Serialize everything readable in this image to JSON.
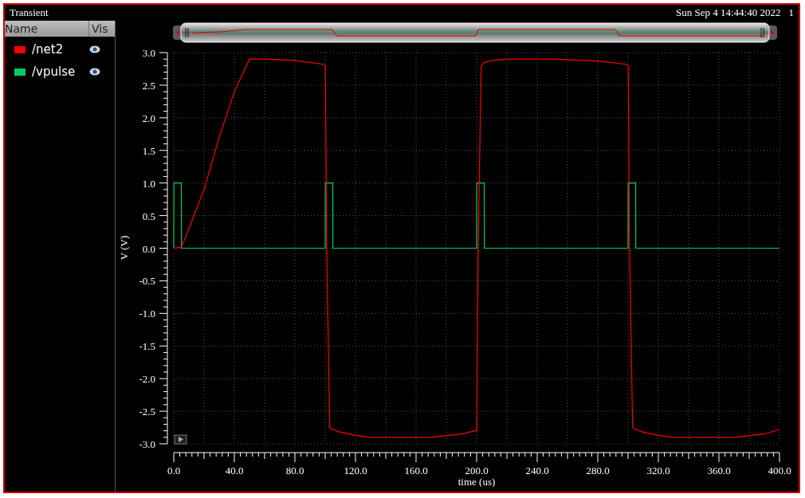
{
  "window": {
    "title": "Transient",
    "timestamp": "Sun Sep 4 14:44:40 2022",
    "number": "1"
  },
  "panel": {
    "columns": [
      "Name",
      "Vis"
    ]
  },
  "chart_data": {
    "type": "line",
    "grid": true,
    "xlabel": "time (us)",
    "ylabel": "V (V)",
    "x": [
      0,
      0.1,
      5,
      5.1,
      10,
      20,
      30,
      40,
      50,
      60,
      80,
      99,
      100,
      100.1,
      101,
      103,
      105,
      105.1,
      110,
      120,
      130,
      150,
      170,
      190,
      199,
      200,
      200.1,
      201,
      203,
      205,
      205.1,
      210,
      220,
      250,
      280,
      299,
      300,
      300.1,
      301,
      303,
      305,
      305.1,
      310,
      320,
      330,
      350,
      370,
      390,
      400
    ],
    "series": [
      {
        "name": "/net2",
        "color": "#ff0000",
        "values": [
          0,
          0,
          0.02,
          0.02,
          0.3,
          0.9,
          1.7,
          2.4,
          2.9,
          2.9,
          2.88,
          2.82,
          2.8,
          2.8,
          0,
          -2.75,
          -2.78,
          -2.78,
          -2.82,
          -2.87,
          -2.9,
          -2.9,
          -2.9,
          -2.85,
          -2.8,
          -2.8,
          -2.8,
          0,
          2.8,
          2.85,
          2.85,
          2.88,
          2.9,
          2.9,
          2.87,
          2.82,
          2.8,
          2.8,
          0,
          -2.75,
          -2.78,
          -2.78,
          -2.82,
          -2.87,
          -2.9,
          -2.9,
          -2.9,
          -2.85,
          -2.78
        ]
      },
      {
        "name": "/vpulse",
        "color": "#00cc66",
        "values": [
          0,
          1,
          1,
          0,
          0,
          0,
          0,
          0,
          0,
          0,
          0,
          0,
          0,
          1,
          1,
          1,
          1,
          0,
          0,
          0,
          0,
          0,
          0,
          0,
          0,
          0,
          1,
          1,
          1,
          1,
          0,
          0,
          0,
          0,
          0,
          0,
          0,
          1,
          1,
          1,
          1,
          0,
          0,
          0,
          0,
          0,
          0,
          0,
          0
        ]
      }
    ],
    "xlim": [
      0,
      400
    ],
    "ylim": [
      -3,
      3
    ],
    "xticks": [
      {
        "value": 0,
        "label": "0.0"
      },
      {
        "value": 40,
        "label": "40.0"
      },
      {
        "value": 80,
        "label": "80.0"
      },
      {
        "value": 120,
        "label": "120.0"
      },
      {
        "value": 160,
        "label": "160.0"
      },
      {
        "value": 200,
        "label": "200.0"
      },
      {
        "value": 240,
        "label": "240.0"
      },
      {
        "value": 280,
        "label": "280.0"
      },
      {
        "value": 320,
        "label": "320.0"
      },
      {
        "value": 360,
        "label": "360.0"
      },
      {
        "value": 400,
        "label": "400.0"
      }
    ],
    "yticks": [
      {
        "value": 3,
        "label": "3.0"
      },
      {
        "value": 2.5,
        "label": "2.5"
      },
      {
        "value": 2,
        "label": "2.0"
      },
      {
        "value": 1.5,
        "label": "1.5"
      },
      {
        "value": 1,
        "label": "1.0"
      },
      {
        "value": 0.5,
        "label": "0.5"
      },
      {
        "value": 0,
        "label": "0.0"
      },
      {
        "value": -0.5,
        "label": "-0.5"
      },
      {
        "value": -1,
        "label": "-1.0"
      },
      {
        "value": -1.5,
        "label": "-1.5"
      },
      {
        "value": -2,
        "label": "-2.0"
      },
      {
        "value": -2.5,
        "label": "-2.5"
      },
      {
        "value": -3,
        "label": "-3.0"
      }
    ]
  }
}
